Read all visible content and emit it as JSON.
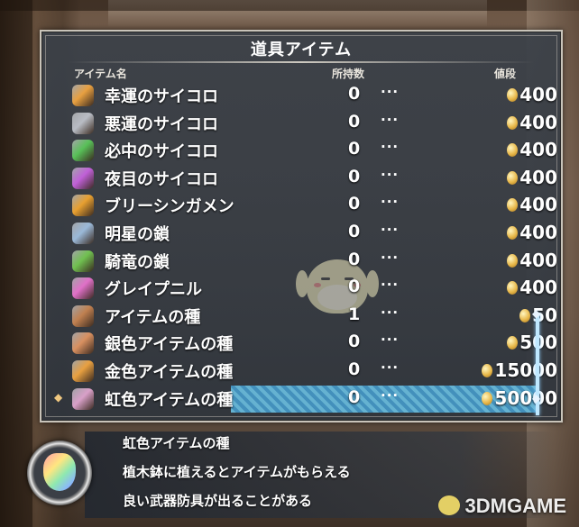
{
  "menu": {
    "title": "道具アイテム",
    "columns": {
      "name": "アイテム名",
      "owned": "所持数",
      "price": "値段"
    },
    "separator": "···",
    "items": [
      {
        "name": "幸運のサイコロ",
        "qty": "0",
        "price": "400",
        "icon": "orange-dice-icon",
        "color": "#e8a040"
      },
      {
        "name": "悪運のサイコロ",
        "qty": "0",
        "price": "400",
        "icon": "gray-dice-icon",
        "color": "#b8bcc4"
      },
      {
        "name": "必中のサイコロ",
        "qty": "0",
        "price": "400",
        "icon": "green-dice-icon",
        "color": "#58c058"
      },
      {
        "name": "夜目のサイコロ",
        "qty": "0",
        "price": "400",
        "icon": "purple-dice-icon",
        "color": "#c060d8"
      },
      {
        "name": "ブリーシンガメン",
        "qty": "0",
        "price": "400",
        "icon": "gold-necklace-icon",
        "color": "#e8a030"
      },
      {
        "name": "明星の鎖",
        "qty": "0",
        "price": "400",
        "icon": "silver-chain-icon",
        "color": "#9ab8d8"
      },
      {
        "name": "騎竜の鎖",
        "qty": "0",
        "price": "400",
        "icon": "green-chain-icon",
        "color": "#70c050"
      },
      {
        "name": "グレイプニル",
        "qty": "0",
        "price": "400",
        "icon": "pink-chain-icon",
        "color": "#e070c8"
      },
      {
        "name": "アイテムの種",
        "qty": "1",
        "price": "50",
        "icon": "seed-icon",
        "color": "#c08050"
      },
      {
        "name": "銀色アイテムの種",
        "qty": "0",
        "price": "500",
        "icon": "silver-seed-icon",
        "color": "#d89060"
      },
      {
        "name": "金色アイテムの種",
        "qty": "0",
        "price": "15000",
        "icon": "gold-seed-icon",
        "color": "#e8a040"
      },
      {
        "name": "虹色アイテムの種",
        "qty": "0",
        "price": "50000",
        "icon": "rainbow-seed-icon",
        "color": "#d8a0c8"
      }
    ]
  },
  "description": {
    "title": "虹色アイテムの種",
    "line1": "植木鉢に植えるとアイテムがもらえる",
    "line2": "良い武器防具が出ることがある"
  },
  "watermark": "3DMGAME"
}
